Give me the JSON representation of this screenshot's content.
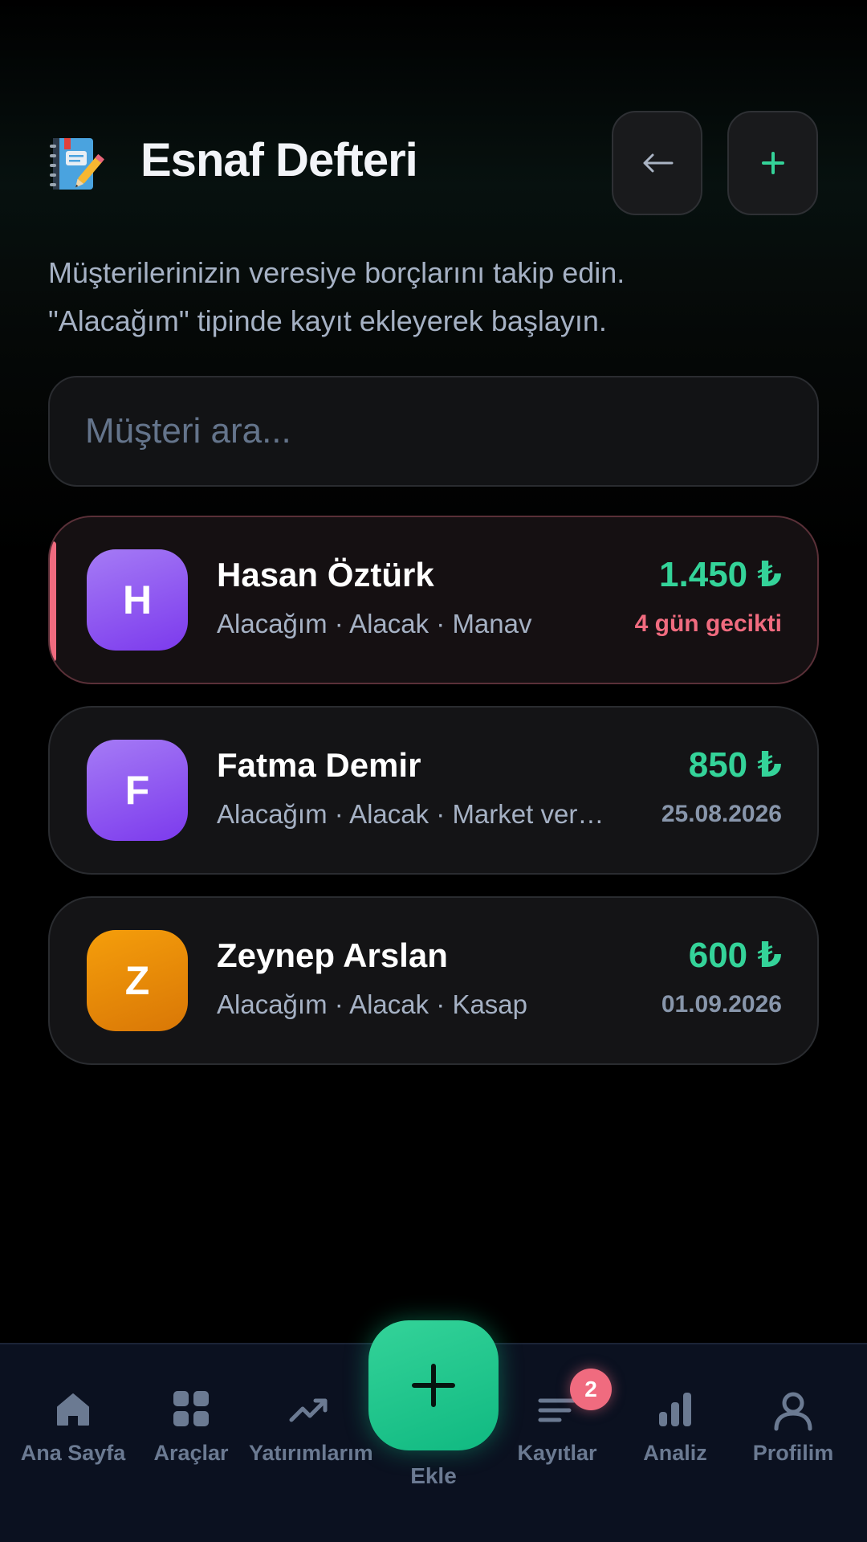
{
  "header": {
    "title": "Esnaf Defteri",
    "logo_icon": "notebook-pencil-icon",
    "back_icon": "arrow-left-icon",
    "add_icon": "plus-icon"
  },
  "description": {
    "line1": "Müşterilerinizin veresiye borçlarını takip edin.",
    "line2": "\"Alacağım\" tipinde kayıt ekleyerek başlayın."
  },
  "search": {
    "placeholder": "Müşteri ara...",
    "value": ""
  },
  "customers": [
    {
      "initial": "H",
      "name": "Hasan Öztürk",
      "meta": "Alacağım · Alacak · Manav",
      "amount": "1.450 ₺",
      "status": "4 gün gecikti",
      "overdue": true,
      "avatar_color": "#8b5cf6"
    },
    {
      "initial": "F",
      "name": "Fatma Demir",
      "meta": "Alacağım · Alacak · Market veresiye",
      "amount": "850 ₺",
      "status": "25.08.2026",
      "overdue": false,
      "avatar_color": "#8b5cf6"
    },
    {
      "initial": "Z",
      "name": "Zeynep Arslan",
      "meta": "Alacağım · Alacak · Kasap",
      "amount": "600 ₺",
      "status": "01.09.2026",
      "overdue": false,
      "avatar_color": "#f59e0b"
    }
  ],
  "nav": {
    "home": "Ana Sayfa",
    "tools": "Araçlar",
    "investments": "Yatırımlarım",
    "add": "Ekle",
    "records": "Kayıtlar",
    "records_badge": "2",
    "analysis": "Analiz",
    "profile": "Profilim"
  },
  "colors": {
    "accent_green": "#34d399",
    "danger": "#f06b7f",
    "muted": "#6b7a92"
  }
}
